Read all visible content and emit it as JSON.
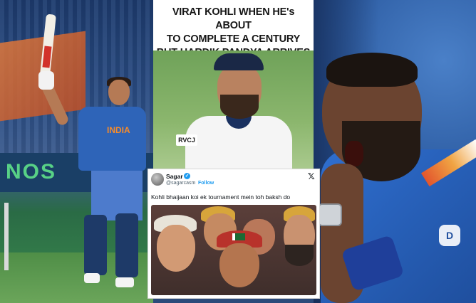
{
  "meme_top": {
    "caption": "VIRAT KOHLI WHEN HE's ABOUT\nTO COMPLETE A CENTURY\nBUT HARDIK PANDYA ARRIVES",
    "watermark": "RVCJ"
  },
  "left_photo": {
    "jersey_text": "INDIA",
    "board_text": "NOS"
  },
  "tweet": {
    "name": "Sagar",
    "handle": "@sagarcasm",
    "separator": "·",
    "follow_label": "Follow",
    "text": "Kohli bhaijaan koi ek tournament mein toh baksh do",
    "close_glyph": "𝕏"
  },
  "right_photo": {
    "sponsor_logo": "D"
  },
  "icons": {
    "verified": "verified-badge-icon",
    "x_logo": "x-logo-icon"
  },
  "colors": {
    "jersey_blue": "#2e64b8",
    "twitter_blue": "#1d9bf0"
  }
}
